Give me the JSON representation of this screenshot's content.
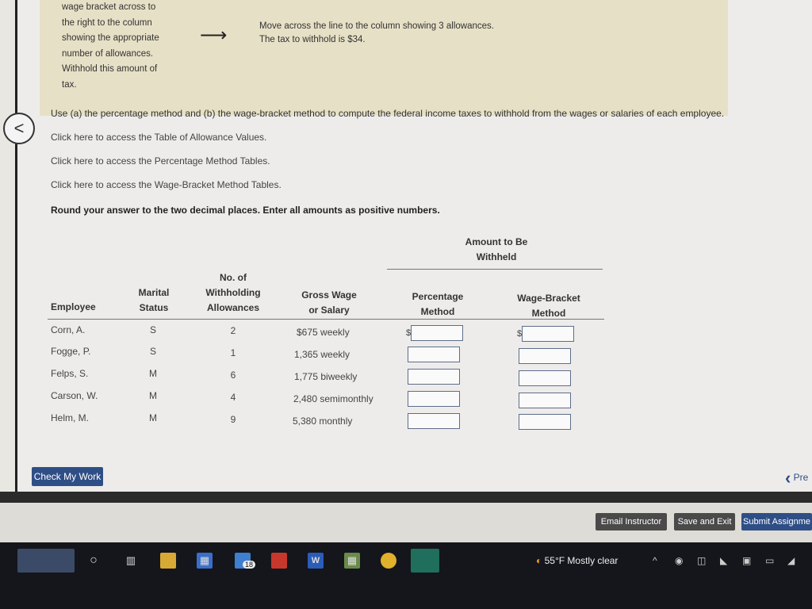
{
  "example": {
    "left_lines": [
      "wage bracket across to",
      "the right to the column",
      "showing the appropriate",
      "number of allowances.",
      "Withhold this amount of",
      "tax."
    ],
    "right_lines": [
      "Move across the line to the column showing 3 allowances.",
      "The tax to withhold is $34."
    ]
  },
  "instructions": "Use (a) the percentage method and (b) the wage-bracket method to compute the federal income taxes to withhold from the wages or salaries of each employee.",
  "links": {
    "allowance": "Click here to access the Table of Allowance Values.",
    "percentage": "Click here to access the Percentage Method Tables.",
    "wage_bracket": "Click here to access the Wage-Bracket Method Tables."
  },
  "round_note": "Round your answer to the two decimal places. Enter all amounts as positive numbers.",
  "table": {
    "group_header_line1": "Amount to Be",
    "group_header_line2": "Withheld",
    "headers": {
      "employee": "Employee",
      "marital_1": "Marital",
      "marital_2": "Status",
      "allow_1": "No. of",
      "allow_2": "Withholding",
      "allow_3": "Allowances",
      "gross_1": "Gross Wage",
      "gross_2": "or Salary",
      "pct_1": "Percentage",
      "pct_2": "Method",
      "wb_1": "Wage-Bracket",
      "wb_2": "Method"
    },
    "rows": [
      {
        "employee": "Corn, A.",
        "status": "S",
        "allowances": "2",
        "wage": "$675 weekly"
      },
      {
        "employee": "Fogge, P.",
        "status": "S",
        "allowances": "1",
        "wage": "1,365 weekly"
      },
      {
        "employee": "Felps, S.",
        "status": "M",
        "allowances": "6",
        "wage": "1,775 biweekly"
      },
      {
        "employee": "Carson, W.",
        "status": "M",
        "allowances": "4",
        "wage": "2,480 semimonthly"
      },
      {
        "employee": "Helm, M.",
        "status": "M",
        "allowances": "9",
        "wage": "5,380 monthly"
      }
    ],
    "dollar_sign": "$"
  },
  "buttons": {
    "check": "Check My Work",
    "previous": "Pre",
    "email": "Email Instructor",
    "save": "Save and Exit",
    "submit": "Submit Assignme"
  },
  "taskbar": {
    "mail_badge": "18",
    "weather": "55°F  Mostly clear"
  }
}
